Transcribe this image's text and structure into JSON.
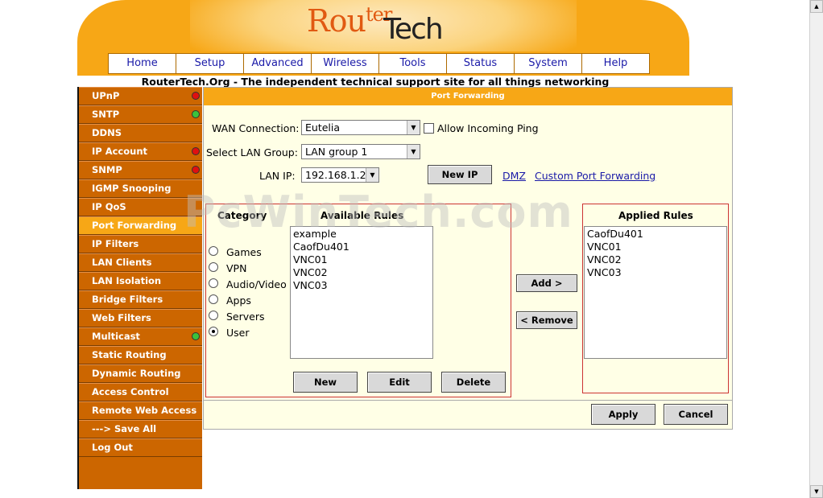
{
  "header": {
    "logo_part1": "Rou",
    "logo_part2": "ter",
    "logo_part3": "Tech"
  },
  "nav": [
    "Home",
    "Setup",
    "Advanced",
    "Wireless",
    "Tools",
    "Status",
    "System",
    "Help"
  ],
  "tagline": "RouterTech.Org - The independent technical support site for all things networking",
  "sidebar": [
    {
      "label": "UPnP",
      "status": "red"
    },
    {
      "label": "SNTP",
      "status": "green"
    },
    {
      "label": "DDNS",
      "status": ""
    },
    {
      "label": "IP Account",
      "status": "red"
    },
    {
      "label": "SNMP",
      "status": "red"
    },
    {
      "label": "IGMP Snooping",
      "status": ""
    },
    {
      "label": "IP QoS",
      "status": ""
    },
    {
      "label": "Port Forwarding",
      "status": "",
      "active": true
    },
    {
      "label": "IP Filters",
      "status": ""
    },
    {
      "label": "LAN Clients",
      "status": ""
    },
    {
      "label": "LAN Isolation",
      "status": ""
    },
    {
      "label": "Bridge Filters",
      "status": ""
    },
    {
      "label": "Web Filters",
      "status": ""
    },
    {
      "label": "Multicast",
      "status": "green"
    },
    {
      "label": "Static Routing",
      "status": ""
    },
    {
      "label": "Dynamic Routing",
      "status": ""
    },
    {
      "label": "Access Control",
      "status": ""
    },
    {
      "label": "Remote Web Access",
      "status": ""
    },
    {
      "label": "---> Save All",
      "status": ""
    },
    {
      "label": "Log Out",
      "status": ""
    }
  ],
  "panel": {
    "title": "Port Forwarding",
    "wan_label": "WAN Connection:",
    "wan_value": "Eutelia",
    "ping_label": "Allow Incoming Ping",
    "lan_group_label": "Select LAN Group:",
    "lan_group_value": "LAN group 1",
    "lan_ip_label": "LAN IP:",
    "lan_ip_value": "192.168.1.2",
    "new_ip_button": "New IP",
    "dmz_link": "DMZ",
    "custom_link": "Custom Port Forwarding",
    "category_header": "Category",
    "available_header": "Available Rules",
    "applied_header": "Applied Rules",
    "categories": [
      "Games",
      "VPN",
      "Audio/Video",
      "Apps",
      "Servers",
      "User"
    ],
    "selected_category": "User",
    "available_rules": [
      "example",
      "CaofDu401",
      "VNC01",
      "VNC02",
      "VNC03"
    ],
    "applied_rules": [
      "CaofDu401",
      "VNC01",
      "VNC02",
      "VNC03"
    ],
    "add_button": "Add >",
    "remove_button": "< Remove",
    "new_button": "New",
    "edit_button": "Edit",
    "delete_button": "Delete",
    "apply_button": "Apply",
    "cancel_button": "Cancel"
  },
  "watermark": "PcWinTech.com",
  "colors": {
    "orange": "#f7a716",
    "sidebar": "#cc6600",
    "panel_bg": "#ffffe6",
    "link": "#1a1aa8"
  }
}
